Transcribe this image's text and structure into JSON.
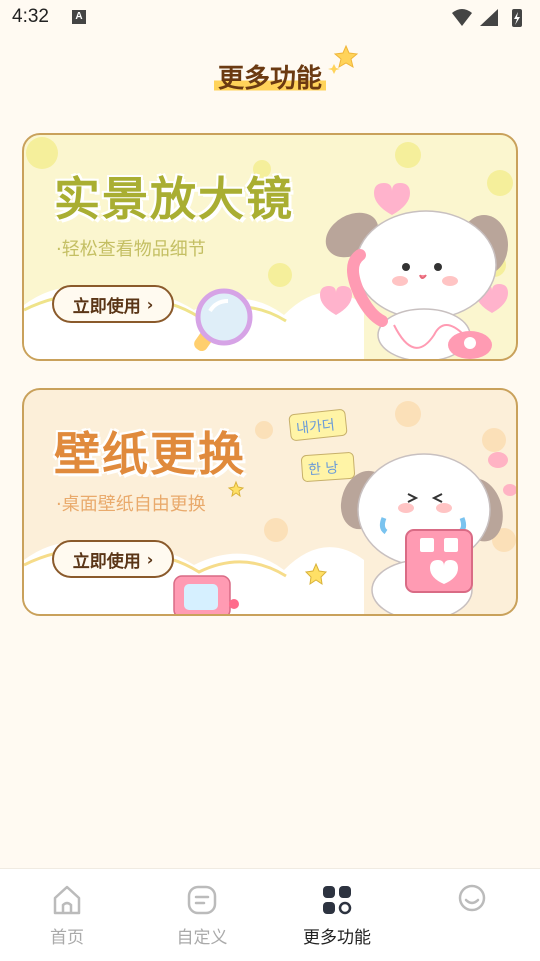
{
  "status_bar": {
    "time": "4:32",
    "notification_badge": "A"
  },
  "page_title": "更多功能",
  "cards": [
    {
      "title": "实景放大镜",
      "subtitle": "·轻松查看物品细节",
      "button_label": "立即使用",
      "button_icon": "chevron-right-icon",
      "accent": "#a9ae32"
    },
    {
      "title": "壁纸更换",
      "subtitle": "·桌面壁纸自由更换",
      "button_label": "立即使用",
      "button_icon": "chevron-right-icon",
      "accent": "#e08a3c",
      "stickers": [
        "내가더",
        "한 낭"
      ]
    }
  ],
  "bottom_nav": [
    {
      "label": "首页",
      "icon": "home-icon",
      "active": false
    },
    {
      "label": "自定义",
      "icon": "customize-icon",
      "active": false
    },
    {
      "label": "更多功能",
      "icon": "grid-icon",
      "active": true
    },
    {
      "label": "",
      "icon": "smiley-icon",
      "active": false
    }
  ]
}
